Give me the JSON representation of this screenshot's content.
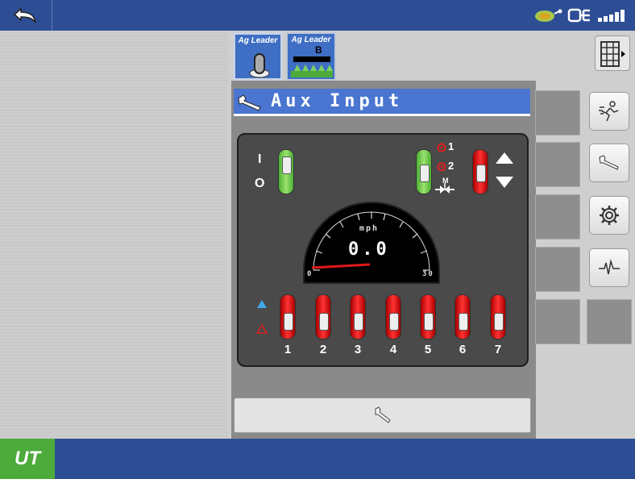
{
  "header": {
    "back_icon": "back-arrow-icon",
    "status_icons": [
      "gps-icon",
      "connection-icon",
      "signal-icon"
    ]
  },
  "tabs": [
    {
      "label": "Ag Leader",
      "icon": "joystick-icon",
      "active": true
    },
    {
      "label": "Ag Leader",
      "sub": "B",
      "icon": "boom-icon",
      "active": false
    }
  ],
  "title": {
    "text": "Aux Input",
    "icon": "wrench-icon"
  },
  "controls": {
    "master_on": "I",
    "master_off": "O",
    "mode_1": "1",
    "mode_2": "2",
    "manual_label": "M"
  },
  "speedometer": {
    "unit": "mph",
    "value": "0.0",
    "min_label": "0",
    "max_label": "30"
  },
  "sections": [
    "1",
    "2",
    "3",
    "4",
    "5",
    "6",
    "7"
  ],
  "side_buttons": [
    "runner-icon",
    "wrench-icon",
    "gear-icon",
    "pulse-icon"
  ],
  "footer": {
    "logo_text": "UT"
  },
  "colors": {
    "top_bar": "#2d4e95",
    "accent_blue": "#4a75d0",
    "green": "#4cab3b",
    "red": "#dd1e1e"
  }
}
